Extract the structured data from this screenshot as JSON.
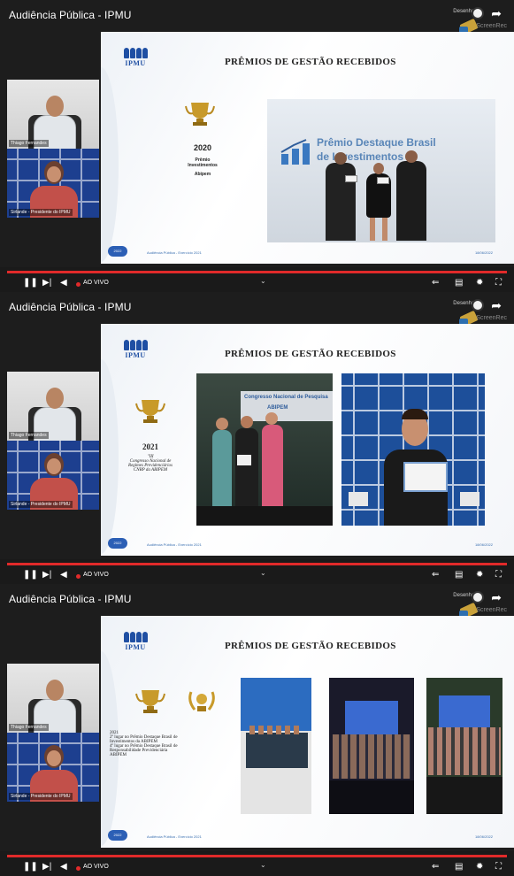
{
  "frames": [
    {
      "video_title": "Audiência Pública - IPMU",
      "topright_text": "Desenhado",
      "topright_mark": "ScreenRec",
      "cam1_label": "Thiago Fernandes",
      "cam2_label": "Sirlande - Presidente do IPMU",
      "slide": {
        "logo_text": "IPMU",
        "title": "PRÊMIOS DE GESTÃO RECEBIDOS",
        "award_year": "2020",
        "award_line1": "Prêmio",
        "award_line2": "Investimentos",
        "award_line3": "Abipem",
        "photo_sign1": "Prêmio Destaque Brasil",
        "photo_sign2": "de Investimentos",
        "footer_pill": "2022",
        "footer_text": "Audiência Pública - Exercício 2021",
        "footer_date": "18/06/2022"
      },
      "player": {
        "live_text": "AO VIVO"
      }
    },
    {
      "video_title": "Audiência Pública - IPMU",
      "topright_text": "Desenhado",
      "topright_mark": "ScreenRec",
      "cam1_label": "Thiago Fernandes",
      "cam2_label": "Sirlande - Presidente do IPMU",
      "slide": {
        "logo_text": "IPMU",
        "title": "PRÊMIOS DE GESTÃO RECEBIDOS",
        "award_year": "2021",
        "award_line1": "\"III",
        "award_line2": "Congresso Nacional de",
        "award_line3": "Regimes Previdenciários",
        "award_line4": "CNRP da ABIPEM",
        "photo_sign1": "Congresso Nacional de Pesquisa",
        "photo_sign2": "ABIPEM",
        "footer_pill": "2022",
        "footer_text": "Audiência Pública - Exercício 2021",
        "footer_date": "18/06/2022"
      },
      "player": {
        "live_text": "AO VIVO"
      }
    },
    {
      "video_title": "Audiência Pública - IPMU",
      "topright_text": "Desenhado",
      "topright_mark": "ScreenRec",
      "cam1_label": "Thiago Fernandes",
      "cam2_label": "Sirlande - Presidente do IPMU",
      "slide": {
        "logo_text": "IPMU",
        "title": "PRÊMIOS DE GESTÃO RECEBIDOS",
        "award_year": "2021",
        "award_line1": "2º lugar no Prêmio Destaque Brasil de",
        "award_line2": "Investimentos da ABIPEM",
        "award_line3": "4º lugar no Prêmio Destaque Brasil de",
        "award_line4": "Responsabilidade Previdenciária",
        "award_line5": "ABIPEM",
        "footer_pill": "2022",
        "footer_text": "Audiência Pública - Exercício 2021",
        "footer_date": "18/06/2022"
      },
      "player": {
        "live_text": "AO VIVO"
      }
    }
  ],
  "colors": {
    "accent_red": "#e12a2a",
    "brand_blue": "#1f4fa3",
    "player_bg": "#1a1a1a"
  }
}
